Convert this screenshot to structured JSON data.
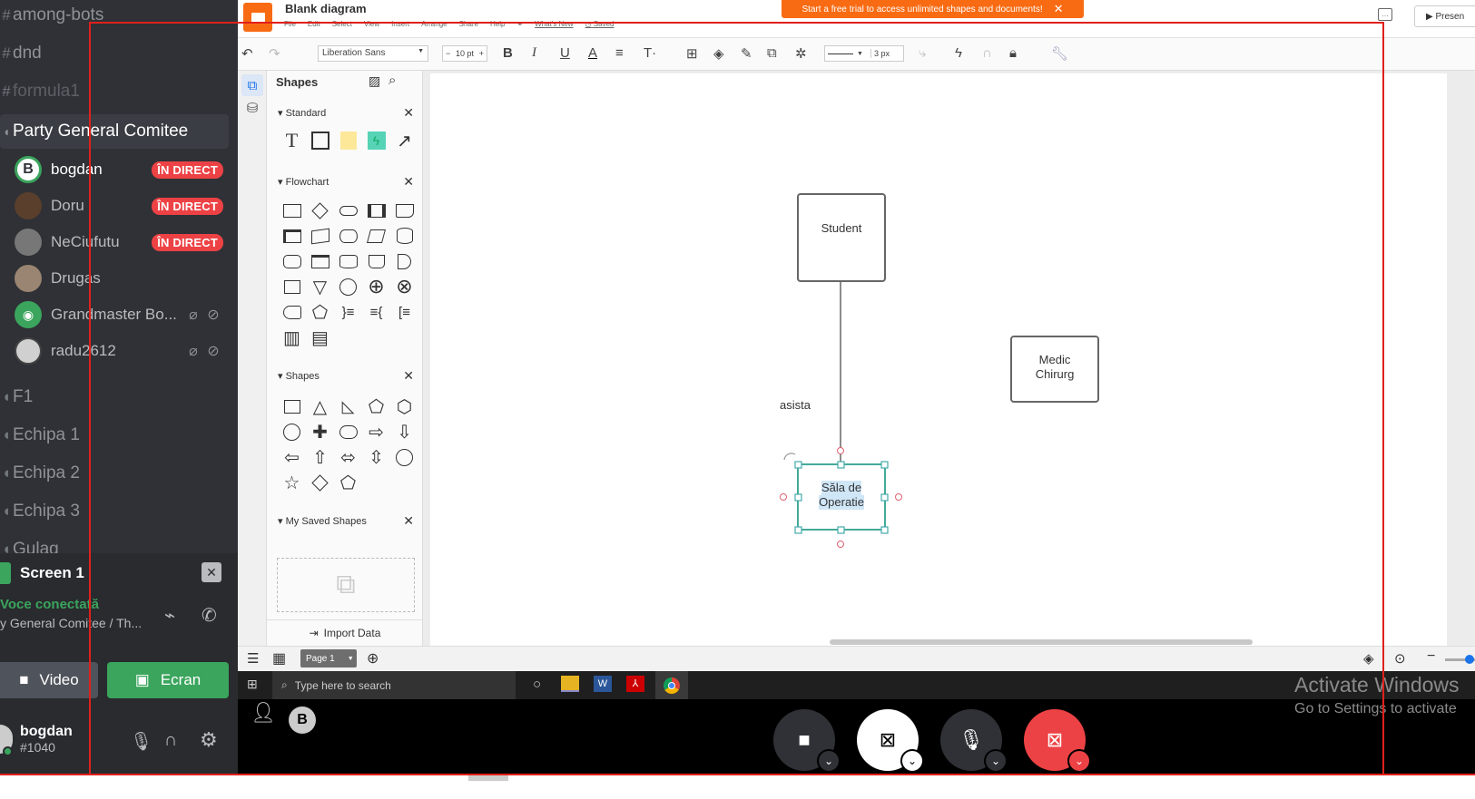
{
  "discord": {
    "channels_top": [
      {
        "name": "among-bots"
      },
      {
        "name": "dnd"
      },
      {
        "name": "formula1"
      }
    ],
    "active_voice_channel": "Party General Comitee",
    "voice_users": [
      {
        "name": "bogdan",
        "badge": "ÎN DIRECT"
      },
      {
        "name": "Doru",
        "badge": "ÎN DIRECT"
      },
      {
        "name": "NeCiufutu",
        "badge": "ÎN DIRECT"
      },
      {
        "name": "Drugas",
        "badge": ""
      },
      {
        "name": "Grandmaster Bo...",
        "badge": ""
      },
      {
        "name": "radu2612",
        "badge": ""
      }
    ],
    "channels_bottom": [
      {
        "name": "F1"
      },
      {
        "name": "Echipa 1"
      },
      {
        "name": "Echipa 2"
      },
      {
        "name": "Echipa 3"
      },
      {
        "name": "Gulag"
      }
    ],
    "stream_label": "Screen 1",
    "voice_status": "Voce conectată",
    "voice_location": "y General Comitee / Th...",
    "video_label": "Video",
    "screen_label": "Ecran",
    "user": {
      "name": "bogdan",
      "tag": "#1040"
    },
    "colors": {
      "live": "#ed4245",
      "green": "#3ba55d",
      "bg": "#2f3136"
    }
  },
  "lucid": {
    "title": "Blank diagram",
    "menu": [
      "File",
      "Edit",
      "Select",
      "View",
      "Insert",
      "Arrange",
      "Share",
      "Help"
    ],
    "whats_new": "What's New",
    "saved": "Saved",
    "banner": "Start a free trial to access unlimited shapes and documents!",
    "present": "Presen",
    "font_name": "Liberation Sans",
    "font_size": "10 pt",
    "line_width": "3 px",
    "panel_title": "Shapes",
    "sections": {
      "standard": "Standard",
      "flowchart": "Flowchart",
      "shapes": "Shapes",
      "saved": "My Saved Shapes"
    },
    "import_data": "Import Data",
    "page_tab": "Page 1",
    "diagram": {
      "student": "Student",
      "medic_line1": "Medic",
      "medic_line2": "Chirurg",
      "edge_label": "asista",
      "sala_line1": "Săla de",
      "sala_line2": "Operatie"
    }
  },
  "taskbar": {
    "search_placeholder": "Type here to search"
  },
  "watermark": {
    "line1": "Activate Windows",
    "line2": "Go to Settings to activate"
  }
}
